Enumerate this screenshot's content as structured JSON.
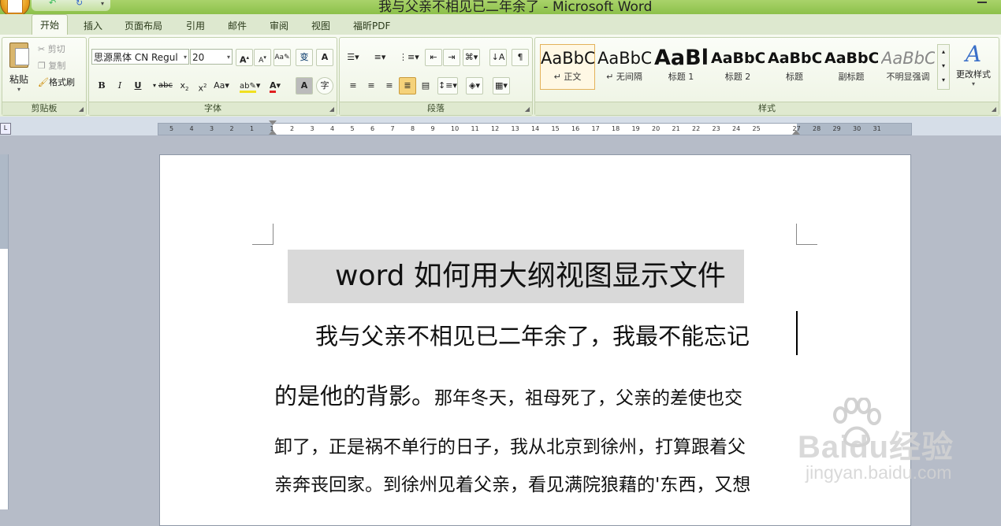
{
  "window": {
    "title": "我与父亲不相见已二年余了 - Microsoft Word"
  },
  "tabs": [
    "开始",
    "插入",
    "页面布局",
    "引用",
    "邮件",
    "审阅",
    "视图",
    "福昕PDF"
  ],
  "active_tab": "开始",
  "clipboard": {
    "paste": "粘贴",
    "cut": "剪切",
    "copy": "复制",
    "format_painter": "格式刷",
    "group": "剪贴板"
  },
  "font": {
    "name": "思源黑体 CN Regul",
    "size": "20",
    "group": "字体"
  },
  "paragraph": {
    "group": "段落"
  },
  "styles": {
    "group": "样式",
    "change_styles": "更改样式",
    "items": [
      {
        "sample": "AaBbC(",
        "name": "↵ 正文"
      },
      {
        "sample": "AaBbC(",
        "name": "↵ 无间隔"
      },
      {
        "sample": "AaBl",
        "name": "标题 1"
      },
      {
        "sample": "AaBbC(",
        "name": "标题 2"
      },
      {
        "sample": "AaBbC",
        "name": "标题"
      },
      {
        "sample": "AaBbC(",
        "name": "副标题"
      },
      {
        "sample": "AaBbC(",
        "name": "不明显强调"
      }
    ]
  },
  "ruler": {
    "labels": [
      "5",
      "4",
      "3",
      "2",
      "1",
      "1",
      "2",
      "3",
      "4",
      "5",
      "6",
      "7",
      "8",
      "9",
      "10",
      "11",
      "12",
      "13",
      "14",
      "15",
      "16",
      "17",
      "18",
      "19",
      "20",
      "21",
      "22",
      "23",
      "24",
      "25",
      "27",
      "28",
      "29",
      "30",
      "31"
    ]
  },
  "document": {
    "title": "word 如何用大纲视图显示文件",
    "lines": [
      "我与父亲不相见已二年余了，我最不能忘记",
      "的是他的背影。",
      "那年冬天，祖母死了，父亲的差使也交",
      "卸了，正是祸不单行的日子，我从北京到徐州，打算跟着父",
      "亲奔丧回家。到徐州见着父亲，看见满院狼藉的'东西，又想"
    ]
  },
  "watermark": {
    "brand": "Baidu经验",
    "url": "jingyan.baidu.com"
  },
  "colors": {
    "titlebar": "#8cc04a",
    "font_color": "#e02020",
    "highlight": "#f0e020",
    "title_shading": "#d9d9d9"
  }
}
